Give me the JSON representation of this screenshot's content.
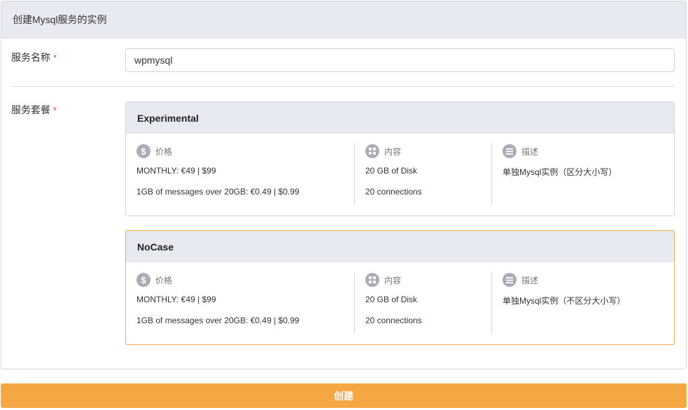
{
  "form": {
    "title": "创建Mysql服务的实例",
    "name_label": "服务名称",
    "name_value": "wpmysql",
    "plan_label": "服务套餐",
    "required_mark": "*"
  },
  "plans": [
    {
      "name": "Experimental",
      "selected": false,
      "price_title": "价格",
      "price_lines": [
        "MONTHLY: €49 | $99",
        "1GB of messages over 20GB: €0.49 | $0.99"
      ],
      "content_title": "内容",
      "content_lines": [
        "20 GB of Disk",
        "20 connections"
      ],
      "desc_title": "描述",
      "desc_lines": [
        "单独Mysql实例（区分大小写）"
      ]
    },
    {
      "name": "NoCase",
      "selected": true,
      "price_title": "价格",
      "price_lines": [
        "MONTHLY: €49 | $99",
        "1GB of messages over 20GB: €0.49 | $0.99"
      ],
      "content_title": "内容",
      "content_lines": [
        "20 GB of Disk",
        "20 connections"
      ],
      "desc_title": "描述",
      "desc_lines": [
        "单独Mysql实例（不区分大小写）"
      ]
    }
  ],
  "actions": {
    "create_label": "创建"
  },
  "icons": {
    "price": "dollar-icon",
    "content": "grid-icon",
    "desc": "list-icon"
  },
  "colors": {
    "accent": "#f5a743",
    "selected_border": "#f0ad4e",
    "header_bg": "#e8eaf2",
    "required": "#e0483b",
    "icon_gray": "#a8adb6"
  }
}
